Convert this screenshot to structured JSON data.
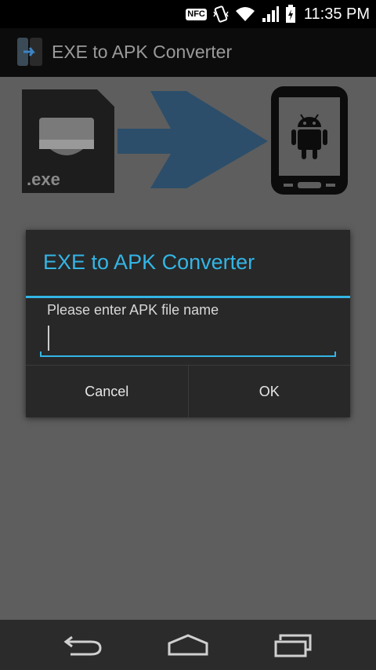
{
  "status_bar": {
    "nfc_label": "NFC",
    "time": "11:35 PM",
    "icons": [
      "nfc-icon",
      "vibrate-icon",
      "wifi-icon",
      "signal-icon",
      "battery-icon"
    ]
  },
  "action_bar": {
    "title": "EXE to APK Converter",
    "icon": "app-logo-icon"
  },
  "banner": {
    "file_label": ".exe",
    "icons": [
      "exe-file-icon",
      "arrow-right-icon",
      "phone-android-icon"
    ]
  },
  "dialog": {
    "title": "EXE to APK Converter",
    "message": "Please enter APK file name",
    "input_value": "",
    "cancel_label": "Cancel",
    "ok_label": "OK"
  },
  "nav_bar": {
    "icons": [
      "back-icon",
      "home-icon",
      "recents-icon"
    ]
  },
  "colors": {
    "accent": "#33b5e5",
    "dialog_bg": "#282828",
    "dim_bg": "#5e5e5e"
  }
}
